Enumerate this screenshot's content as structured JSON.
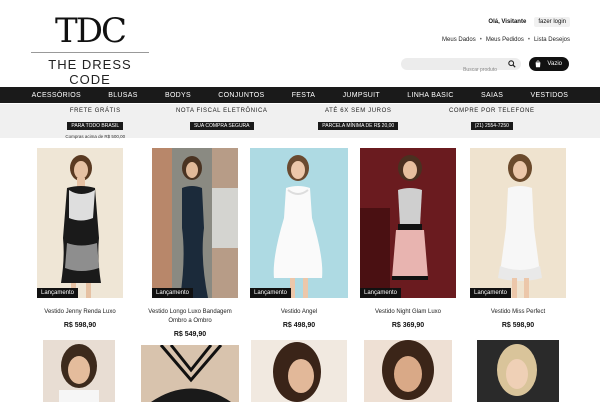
{
  "brand": {
    "mark": "TDC",
    "name": "THE DRESS CODE"
  },
  "header": {
    "greeting": "Olá, Visitante",
    "login": "fazer login",
    "account_links": [
      "Meus Dados",
      "Meus Pedidos",
      "Lista Desejos"
    ],
    "search_placeholder": "Buscar produto",
    "cart_label": "Vazio"
  },
  "nav": [
    "ACESSÓRIOS",
    "BLUSAS",
    "BODYS",
    "CONJUNTOS",
    "FESTA",
    "JUMPSUIT",
    "LINHA BASIC",
    "SAIAS",
    "VESTIDOS"
  ],
  "info_bar": [
    {
      "title": "FRETE GRÁTIS",
      "badge": "PARA TODO BRASIL",
      "sub": "Compras acima de R$ 500,00"
    },
    {
      "title": "NOTA FISCAL ELETRÔNICA",
      "badge": "SUA COMPRA SEGURA",
      "sub": ""
    },
    {
      "title": "ATÉ 6X SEM JUROS",
      "badge": "PARCELA MÍNIMA DE R$ 20,00",
      "sub": ""
    },
    {
      "title": "COMPRE POR TELEFONE",
      "badge": "(21) 2554-7250",
      "sub": ""
    }
  ],
  "products": [
    {
      "name": "Vestido Jenny Renda Luxo",
      "price": "R$ 598,90",
      "badge": "Lançamento"
    },
    {
      "name": "Vestido Longo Luxo Bandagem Ombro a Ombro",
      "price": "R$ 549,90",
      "badge": "Lançamento"
    },
    {
      "name": "Vestido Angel",
      "price": "R$ 498,90",
      "badge": "Lançamento"
    },
    {
      "name": "Vestido Night Glam Luxo",
      "price": "R$ 369,90",
      "badge": "Lançamento"
    },
    {
      "name": "Vestido Miss Perfect",
      "price": "R$ 598,90",
      "badge": "Lançamento"
    }
  ],
  "colors": {
    "nav_bg": "#1a1a1a",
    "info_bg": "#f0f0f0",
    "accent": "#111111"
  }
}
